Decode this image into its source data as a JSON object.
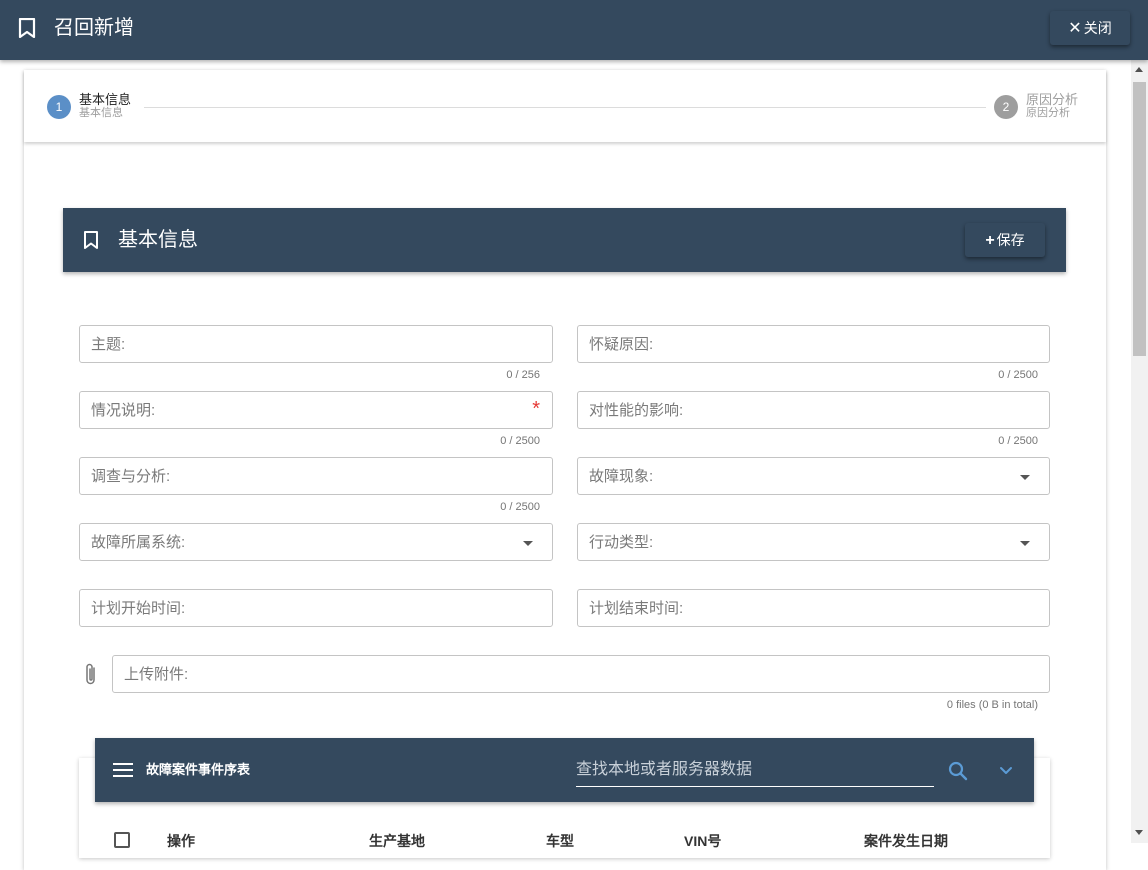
{
  "header": {
    "title": "召回新增",
    "close_label": "关闭"
  },
  "stepper": {
    "steps": [
      {
        "number": "1",
        "title": "基本信息",
        "subtitle": "基本信息"
      },
      {
        "number": "2",
        "title": "原因分析",
        "subtitle": "原因分析"
      }
    ]
  },
  "section": {
    "title": "基本信息",
    "save_label": "保存"
  },
  "form": {
    "subject": {
      "placeholder": "主题:",
      "counter": "0 / 256"
    },
    "suspected_cause": {
      "placeholder": "怀疑原因:",
      "counter": "0 / 2500"
    },
    "situation": {
      "placeholder": "情况说明:",
      "required_mark": "*",
      "counter": "0 / 2500"
    },
    "performance_impact": {
      "placeholder": "对性能的影响:",
      "counter": "0 / 2500"
    },
    "investigation": {
      "placeholder": "调查与分析:",
      "counter": "0 / 2500"
    },
    "fault_phenomenon": {
      "placeholder": "故障现象:"
    },
    "fault_system": {
      "placeholder": "故障所属系统:"
    },
    "action_type": {
      "placeholder": "行动类型:"
    },
    "plan_start": {
      "placeholder": "计划开始时间:"
    },
    "plan_end": {
      "placeholder": "计划结束时间:"
    },
    "attachment": {
      "placeholder": "上传附件:",
      "counter": "0 files (0 B in total)"
    }
  },
  "table": {
    "title": "故障案件事件序表",
    "search_placeholder": "查找本地或者服务器数据",
    "columns": [
      "操作",
      "生产基地",
      "车型",
      "VIN号",
      "案件发生日期"
    ]
  },
  "colors": {
    "header_bg": "#34495e",
    "step_active": "#5b8fc7",
    "step_inactive": "#9e9e9e",
    "required": "#e53935"
  }
}
